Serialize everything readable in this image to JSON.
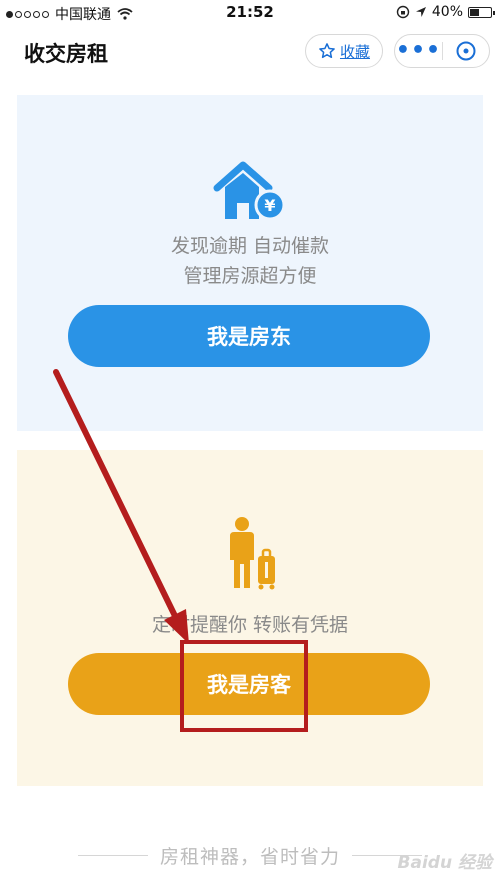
{
  "status_bar": {
    "carrier": "中国联通",
    "time": "21:52",
    "battery": "40%"
  },
  "nav": {
    "title": "收交房租",
    "favorite_label": "收藏",
    "more_label": "•••"
  },
  "landlord_card": {
    "desc_line1": "发现逾期  自动催款",
    "desc_line2": "管理房源超方便",
    "button": "我是房东"
  },
  "tenant_card": {
    "desc": "定时提醒你  转账有凭据",
    "button": "我是房客"
  },
  "footer": {
    "slogan": "房租神器，省时省力"
  },
  "watermark": "Baidu 经验",
  "colors": {
    "blue": "#2a93e6",
    "orange": "#e9a218",
    "annotation_red": "#b41d1d"
  }
}
